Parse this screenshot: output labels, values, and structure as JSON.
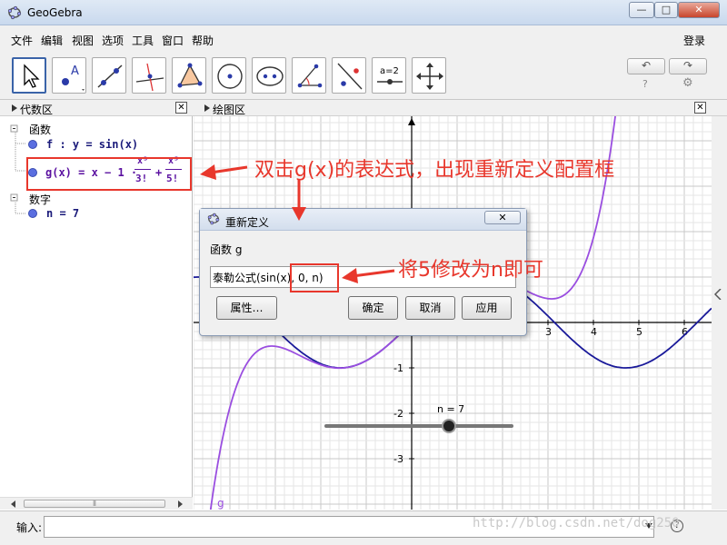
{
  "window": {
    "title": "GeoGebra",
    "btn_min": "—",
    "btn_max": "□",
    "btn_close": "✕"
  },
  "menu": {
    "items": [
      "文件",
      "编辑",
      "视图",
      "选项",
      "工具",
      "窗口",
      "帮助"
    ],
    "login": "登录"
  },
  "toolbar": {
    "tools": [
      "move-tool",
      "point-tool",
      "line-tool",
      "perpendicular-tool",
      "polygon-tool",
      "circle-tool",
      "conic-tool",
      "angle-tool",
      "reflect-tool",
      "slider-tool",
      "move-view-tool"
    ],
    "slider_label": "a=2",
    "undo": "↶",
    "redo": "↷",
    "help": "?",
    "settings": "⚙"
  },
  "algebra": {
    "title": "代数区",
    "close": "✕",
    "group_functions": "函数",
    "f_text": "f : y = sin(x)",
    "g_left": "g(x) = x − 1 ·",
    "g_frac1_num": "x³",
    "g_frac1_den": "3!",
    "g_plus": "+",
    "g_frac2_num": "x⁵",
    "g_frac2_den": "5!",
    "group_numbers": "数字",
    "n_text": "n = 7",
    "scroll_label": "⦀"
  },
  "graphics": {
    "title": "绘图区",
    "close": "✕",
    "x_ticks": [
      "3",
      "4",
      "5",
      "6"
    ],
    "y_ticks": [
      "-1",
      "-2",
      "-3"
    ],
    "slider_label": "n = 7",
    "curve_label": "g",
    "slider_value": 7
  },
  "dialog": {
    "title": "重新定义",
    "close": "✕",
    "label": "函数 g",
    "input_value": "泰勒公式(sin(x), 0, n)",
    "btn_props": "属性…",
    "btn_ok": "确定",
    "btn_cancel": "取消",
    "btn_apply": "应用"
  },
  "input_bar": {
    "label": "输入:",
    "help": "?"
  },
  "annotations": {
    "text1": "双击g(x)的表达式，出现重新定义配置框",
    "text2": "将5修改为n即可"
  },
  "watermark": "http://blog.csdn.net/dog250"
}
